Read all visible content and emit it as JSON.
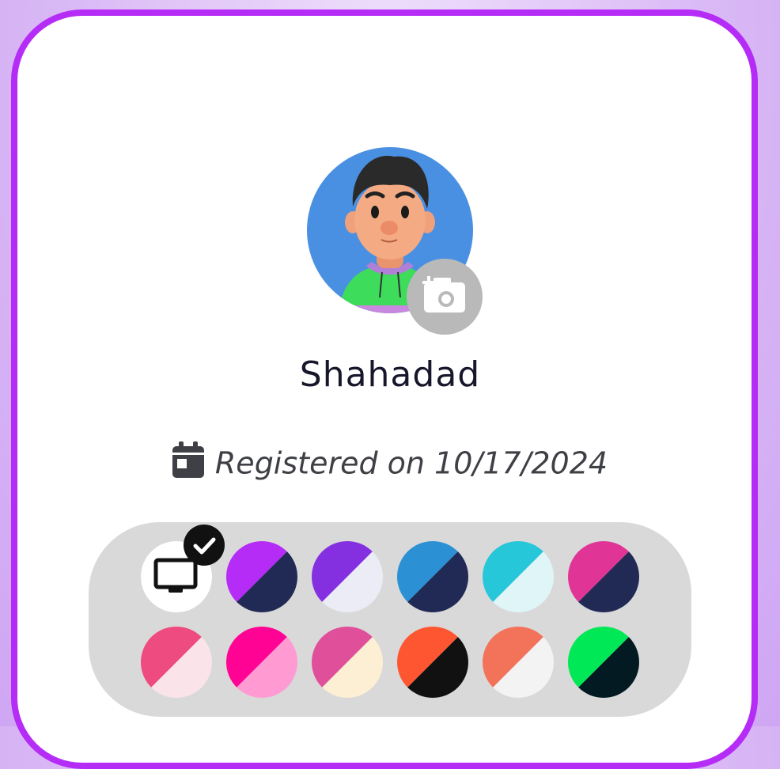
{
  "profile": {
    "username": "Shahadad",
    "registered_text": "Registered on 10/17/2024"
  },
  "icons": {
    "calendar": "calendar-icon",
    "camera": "add-photo-icon",
    "system_theme": "monitor-icon",
    "selected": "check-icon"
  },
  "themes": {
    "selected": "system",
    "options": [
      {
        "id": "system",
        "primary": "#ffffff",
        "secondary": "#ffffff"
      },
      {
        "id": "purple-dark",
        "primary": "#b52cf6",
        "secondary": "#212a55"
      },
      {
        "id": "violet-light",
        "primary": "#8430e0",
        "secondary": "#ececf6"
      },
      {
        "id": "blue-dark",
        "primary": "#2b91d4",
        "secondary": "#212a55"
      },
      {
        "id": "cyan-light",
        "primary": "#27c7da",
        "secondary": "#dff5f7"
      },
      {
        "id": "magenta-dark",
        "primary": "#e03597",
        "secondary": "#212a55"
      },
      {
        "id": "pink-light",
        "primary": "#ee4b80",
        "secondary": "#fbe3ea"
      },
      {
        "id": "hotpink-pink",
        "primary": "#ff0494",
        "secondary": "#ff9bd2"
      },
      {
        "id": "rose-cream",
        "primary": "#e0509a",
        "secondary": "#fdefd3"
      },
      {
        "id": "orange-black",
        "primary": "#ff5632",
        "secondary": "#111111"
      },
      {
        "id": "coral-light",
        "primary": "#f2725a",
        "secondary": "#f3f3f3"
      },
      {
        "id": "green-navy",
        "primary": "#00e856",
        "secondary": "#041a22"
      }
    ]
  },
  "colors": {
    "accent": "#b52cf6",
    "avatar_bg": "#4a90e2"
  }
}
